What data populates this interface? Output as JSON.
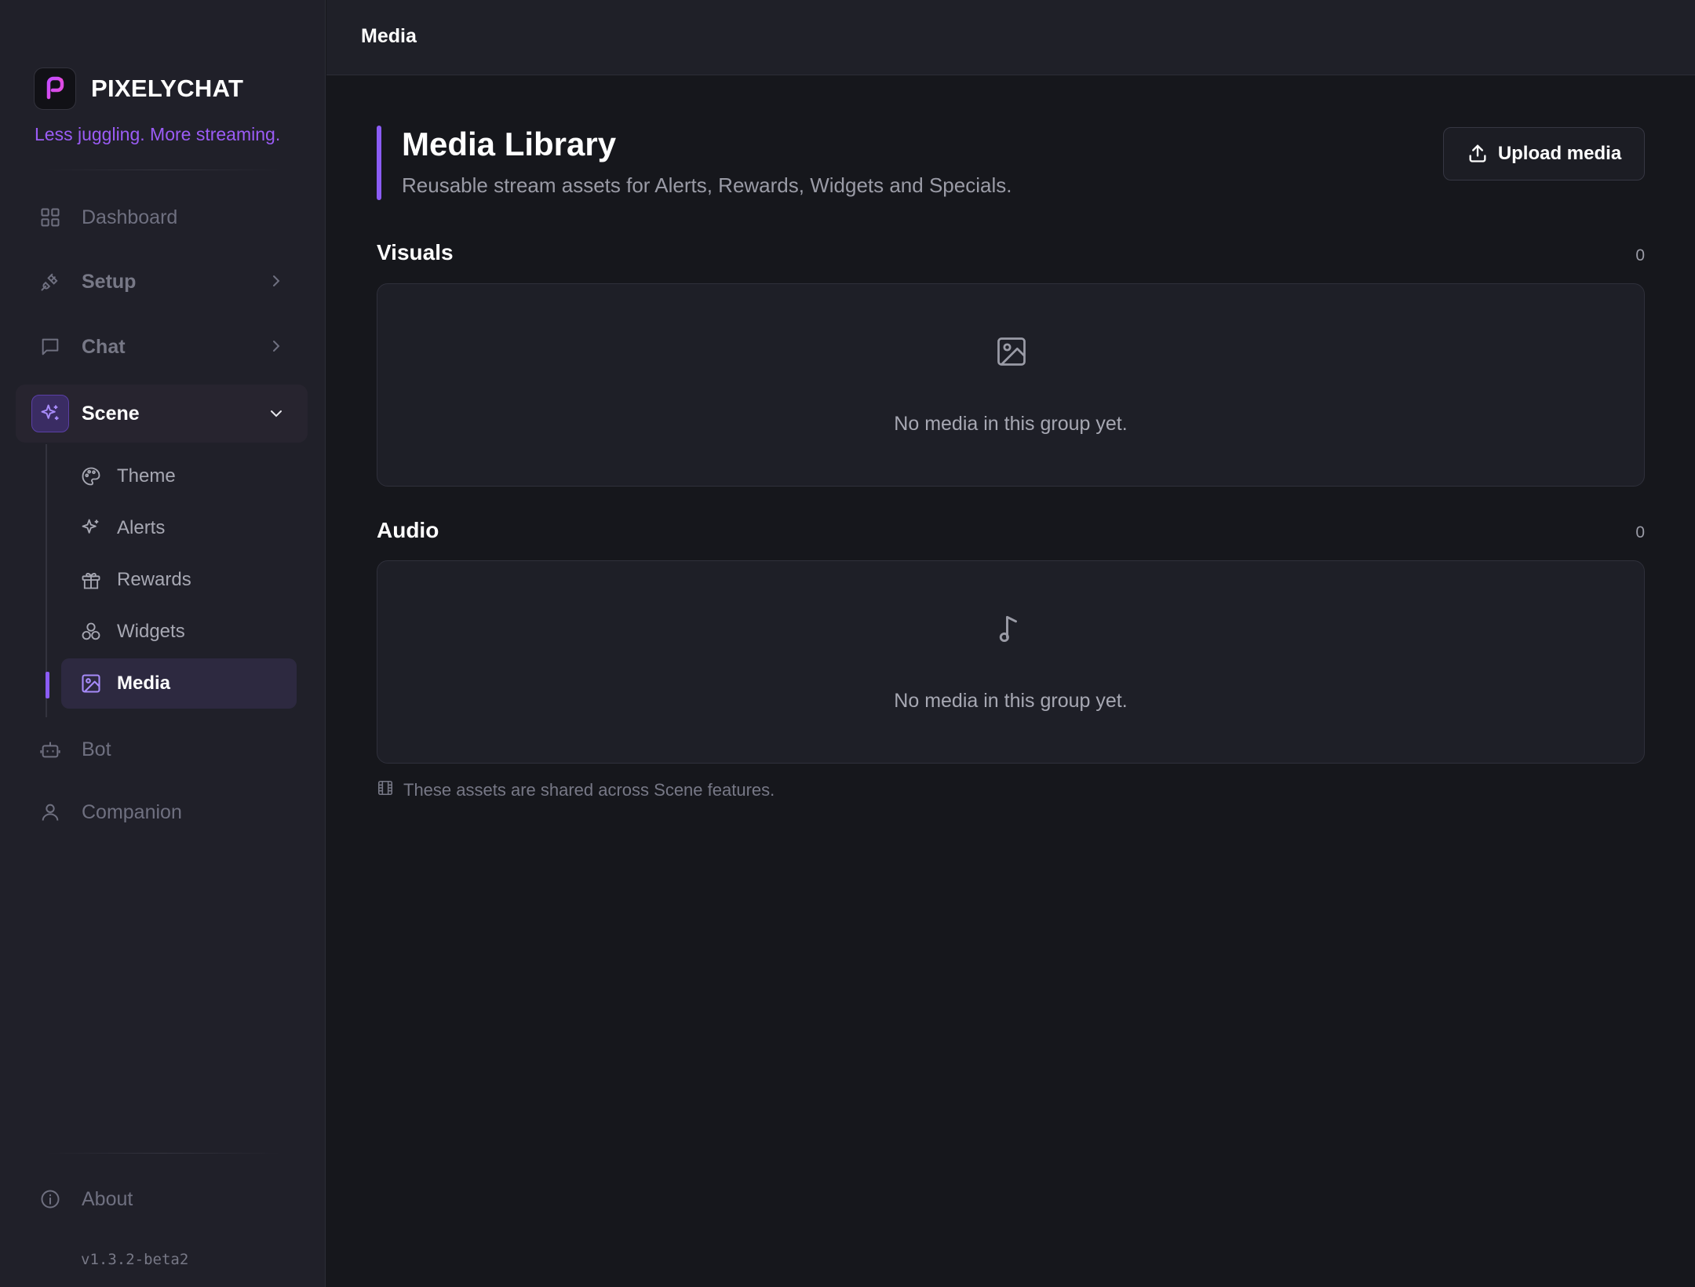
{
  "app": {
    "name": "PIXELYCHAT",
    "tagline": "Less juggling. More streaming.",
    "version": "v1.3.2-beta2",
    "accent_color": "#8b5cf6"
  },
  "sidebar": {
    "items": [
      {
        "label": "Dashboard",
        "icon": "grid-icon"
      },
      {
        "label": "Setup",
        "icon": "plug-icon"
      },
      {
        "label": "Chat",
        "icon": "message-square-icon"
      },
      {
        "label": "Scene",
        "icon": "sparkles-icon"
      },
      {
        "label": "Bot",
        "icon": "bot-icon"
      },
      {
        "label": "Companion",
        "icon": "user-icon"
      }
    ],
    "scene_subitems": [
      {
        "label": "Theme",
        "icon": "palette-icon"
      },
      {
        "label": "Alerts",
        "icon": "sparkles-icon"
      },
      {
        "label": "Rewards",
        "icon": "gift-icon"
      },
      {
        "label": "Widgets",
        "icon": "shapes-icon"
      },
      {
        "label": "Media",
        "icon": "image-icon"
      }
    ],
    "footer": {
      "about_label": "About",
      "icon": "info-icon"
    }
  },
  "topbar": {
    "title": "Media"
  },
  "main": {
    "title": "Media Library",
    "subtitle": "Reusable stream assets for Alerts, Rewards, Widgets and Specials.",
    "upload_label": "Upload media",
    "sections": [
      {
        "title": "Visuals",
        "count": "0",
        "empty_text": "No media in this group yet.",
        "icon": "image-icon"
      },
      {
        "title": "Audio",
        "count": "0",
        "empty_text": "No media in this group yet.",
        "icon": "music-icon"
      }
    ],
    "footnote": "These assets are shared across Scene features."
  }
}
